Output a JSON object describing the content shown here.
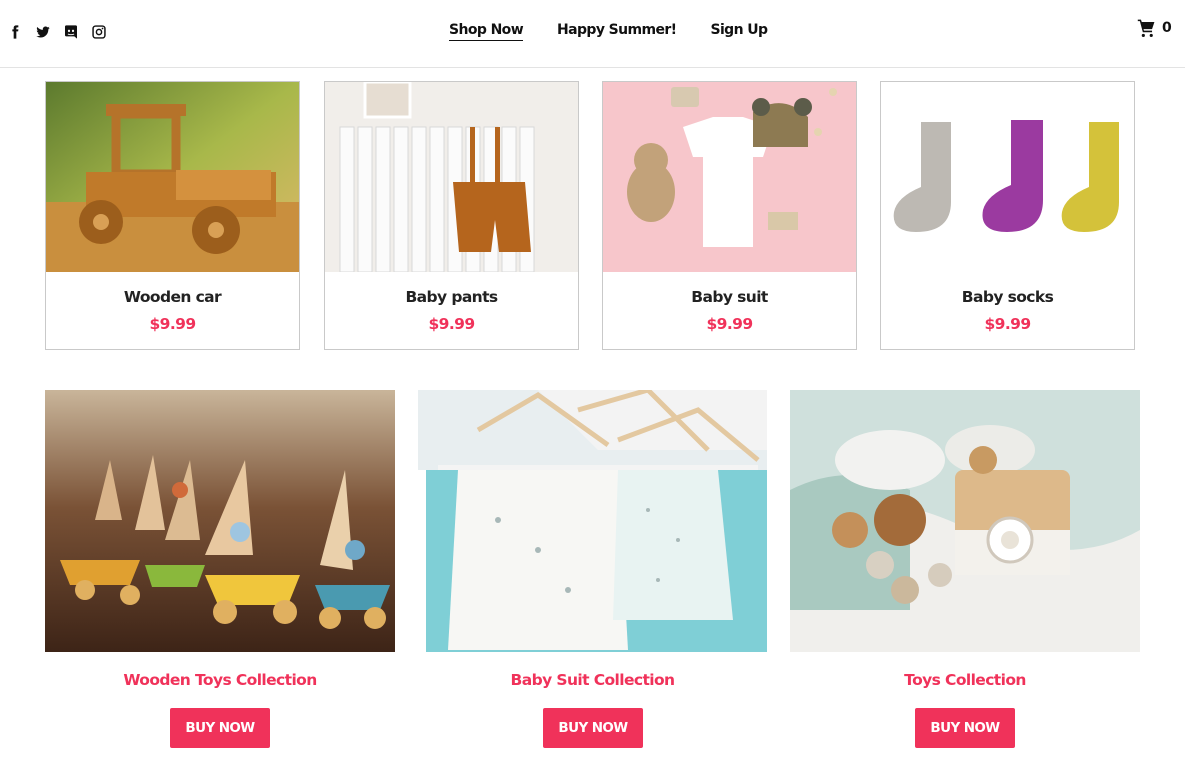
{
  "header": {
    "social": [
      "facebook-icon",
      "twitter-icon",
      "discord-icon",
      "instagram-icon"
    ],
    "nav": [
      {
        "label": "Shop Now",
        "active": true
      },
      {
        "label": "Happy Summer!",
        "active": false
      },
      {
        "label": "Sign Up",
        "active": false
      }
    ],
    "cart": {
      "icon": "cart-icon",
      "count": "0"
    }
  },
  "products": [
    {
      "name": "Wooden car",
      "price": "$9.99"
    },
    {
      "name": "Baby pants",
      "price": "$9.99"
    },
    {
      "name": "Baby suit",
      "price": "$9.99"
    },
    {
      "name": "Baby socks",
      "price": "$9.99"
    }
  ],
  "collections": [
    {
      "title": "Wooden Toys Collection",
      "button": "BUY NOW"
    },
    {
      "title": "Baby Suit Collection",
      "button": "BUY NOW"
    },
    {
      "title": "Toys Collection",
      "button": "BUY NOW"
    }
  ],
  "colors": {
    "accent": "#f0325a",
    "text": "#111111",
    "border": "#c9c9c9"
  }
}
